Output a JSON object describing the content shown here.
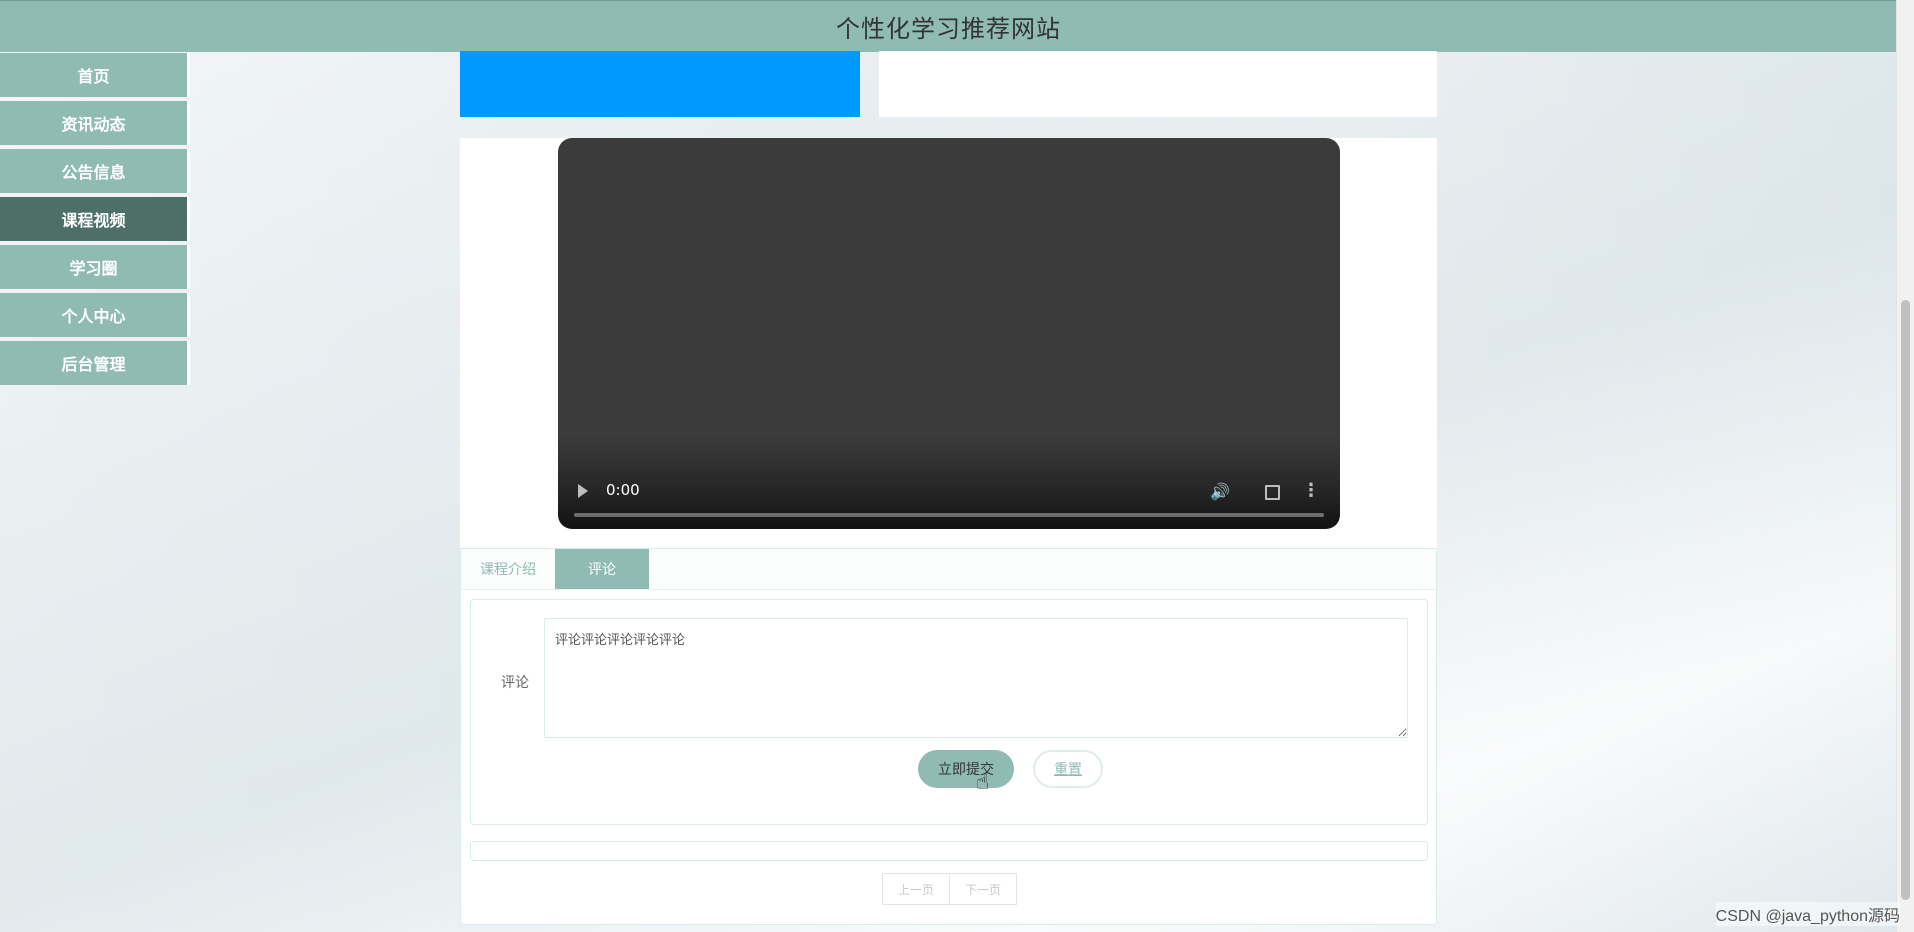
{
  "header": {
    "title": "个性化学习推荐网站"
  },
  "sidebar": {
    "items": [
      {
        "label": "首页"
      },
      {
        "label": "资讯动态"
      },
      {
        "label": "公告信息"
      },
      {
        "label": "课程视频",
        "active": true
      },
      {
        "label": "学习圈"
      },
      {
        "label": "个人中心"
      },
      {
        "label": "后台管理"
      }
    ]
  },
  "video": {
    "time": "0:00"
  },
  "tabs": [
    {
      "label": "课程介绍"
    },
    {
      "label": "评论",
      "active": true
    }
  ],
  "comment_form": {
    "label": "评论",
    "value": "评论评论评论评论评论",
    "submit_label": "立即提交",
    "reset_label": "重置"
  },
  "pagination": {
    "prev_label": "上一页",
    "next_label": "下一页"
  },
  "watermark": "CSDN @java_python源码",
  "colors": {
    "primary": "#8fbbb3",
    "active_nav": "#4c7068",
    "banner_blue": "#0099ff"
  }
}
